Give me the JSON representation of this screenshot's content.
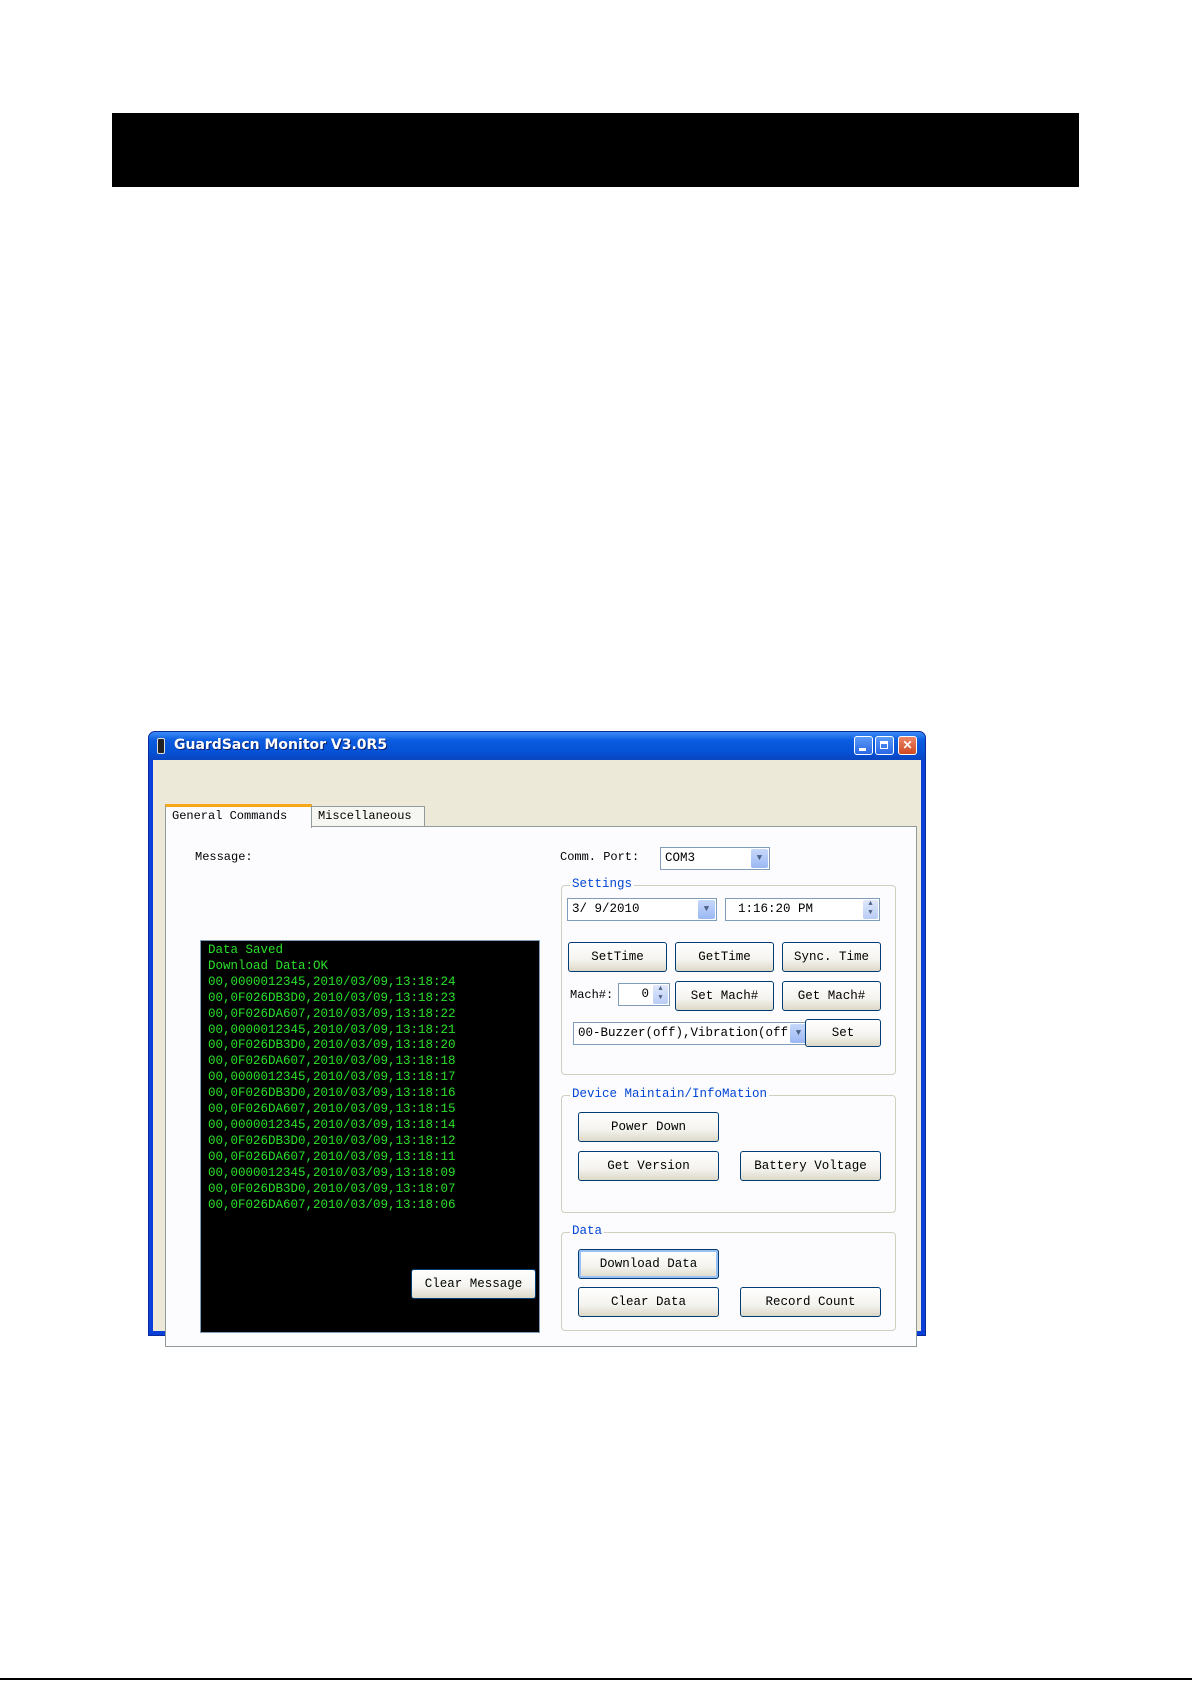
{
  "window": {
    "title": "GuardSacn Monitor V3.0R5",
    "minimize": "_",
    "maximize": "□",
    "close": "✕"
  },
  "tabs": [
    {
      "label": "General Commands",
      "active": true
    },
    {
      "label": "Miscellaneous",
      "active": false
    }
  ],
  "message": {
    "label": "Message:",
    "lines": [
      "Data Saved",
      "Download Data:OK",
      "00,0000012345,2010/03/09,13:18:24",
      "00,0F026DB3D0,2010/03/09,13:18:23",
      "00,0F026DA607,2010/03/09,13:18:22",
      "00,0000012345,2010/03/09,13:18:21",
      "00,0F026DB3D0,2010/03/09,13:18:20",
      "00,0F026DA607,2010/03/09,13:18:18",
      "00,0000012345,2010/03/09,13:18:17",
      "00,0F026DB3D0,2010/03/09,13:18:16",
      "00,0F026DA607,2010/03/09,13:18:15",
      "00,0000012345,2010/03/09,13:18:14",
      "00,0F026DB3D0,2010/03/09,13:18:12",
      "00,0F026DA607,2010/03/09,13:18:11",
      "00,0000012345,2010/03/09,13:18:09",
      "00,0F026DB3D0,2010/03/09,13:18:07",
      "00,0F026DA607,2010/03/09,13:18:06"
    ],
    "clear_button": "Clear Message"
  },
  "comm": {
    "label": "Comm. Port:",
    "value": "COM3"
  },
  "settings": {
    "title": "Settings",
    "date": "3/ 9/2010",
    "time": "1:16:20 PM",
    "set_time": "SetTime",
    "get_time": "GetTime",
    "sync_time": "Sync. Time",
    "mach_label": "Mach#:",
    "mach_value": "0",
    "set_mach": "Set Mach#",
    "get_mach": "Get Mach#",
    "mode_value": "00-Buzzer(off),Vibration(off",
    "set": "Set"
  },
  "device": {
    "title": "Device Maintain/InfoMation",
    "power_down": "Power Down",
    "get_version": "Get Version",
    "battery_voltage": "Battery Voltage"
  },
  "data": {
    "title": "Data",
    "download": "Download Data",
    "clear": "Clear Data",
    "record_count": "Record Count"
  }
}
